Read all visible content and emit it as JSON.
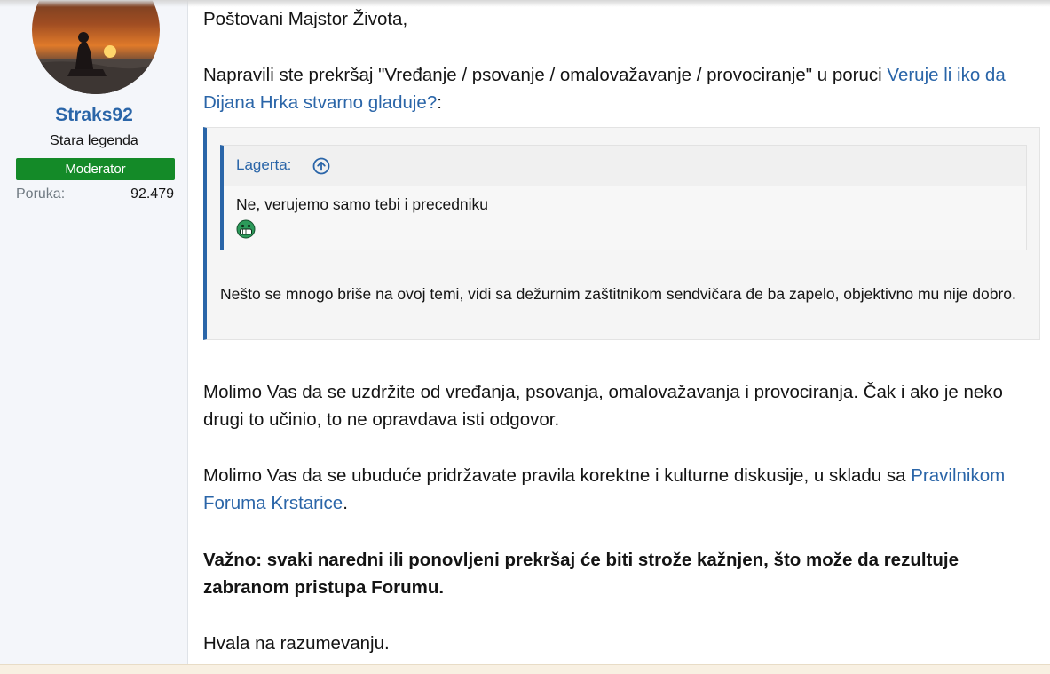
{
  "sidebar": {
    "username": "Straks92",
    "user_title": "Stara legenda",
    "badge": "Moderator",
    "stats": {
      "label": "Poruka:",
      "value": "92.479"
    }
  },
  "message": {
    "greeting": "Poštovani Majstor Života,",
    "violation_prefix": "Napravili ste prekršaj \"Vređanje / psovanje / omalovažavanje / provociranje\" u poruci ",
    "thread_link": "Veruje li iko da Dijana Hrka stvarno gladuje?",
    "violation_suffix": ":",
    "quote": {
      "inner_author": "Lagerta:",
      "inner_text": "Ne, verujemo samo tebi i precedniku",
      "text": "Nešto se mnogo briše na ovoj temi, vidi sa dežurnim zaštitnikom sendvičara đe ba zapelo, objektivno mu nije dobro."
    },
    "request": "Molimo Vas da se uzdržite od vređanja, psovanja, omalovažavanja i provociranja. Čak i ako je neko drugi to učinio, to ne opravdava isti odgovor.",
    "rules_prefix": "Molimo Vas da se ubuduće pridržavate pravila korektne i kulturne diskusije, u skladu sa ",
    "rules_link": "Pravilnikom Foruma Krstarice",
    "rules_suffix": ".",
    "warning": "Važno: svaki naredni ili ponovljeni prekršaj će biti strože kažnjen, što može da rezultuje zabranom pristupa Forumu.",
    "thanks": "Hvala na razumevanju."
  },
  "colors": {
    "link": "#2a65a8",
    "badge": "#148a28",
    "sidebar_bg": "#f4f6fa",
    "quote_border": "#2a65a8"
  },
  "icons": [
    "avatar-image",
    "arrow-up-circle-icon",
    "grinning-smiley-icon"
  ]
}
